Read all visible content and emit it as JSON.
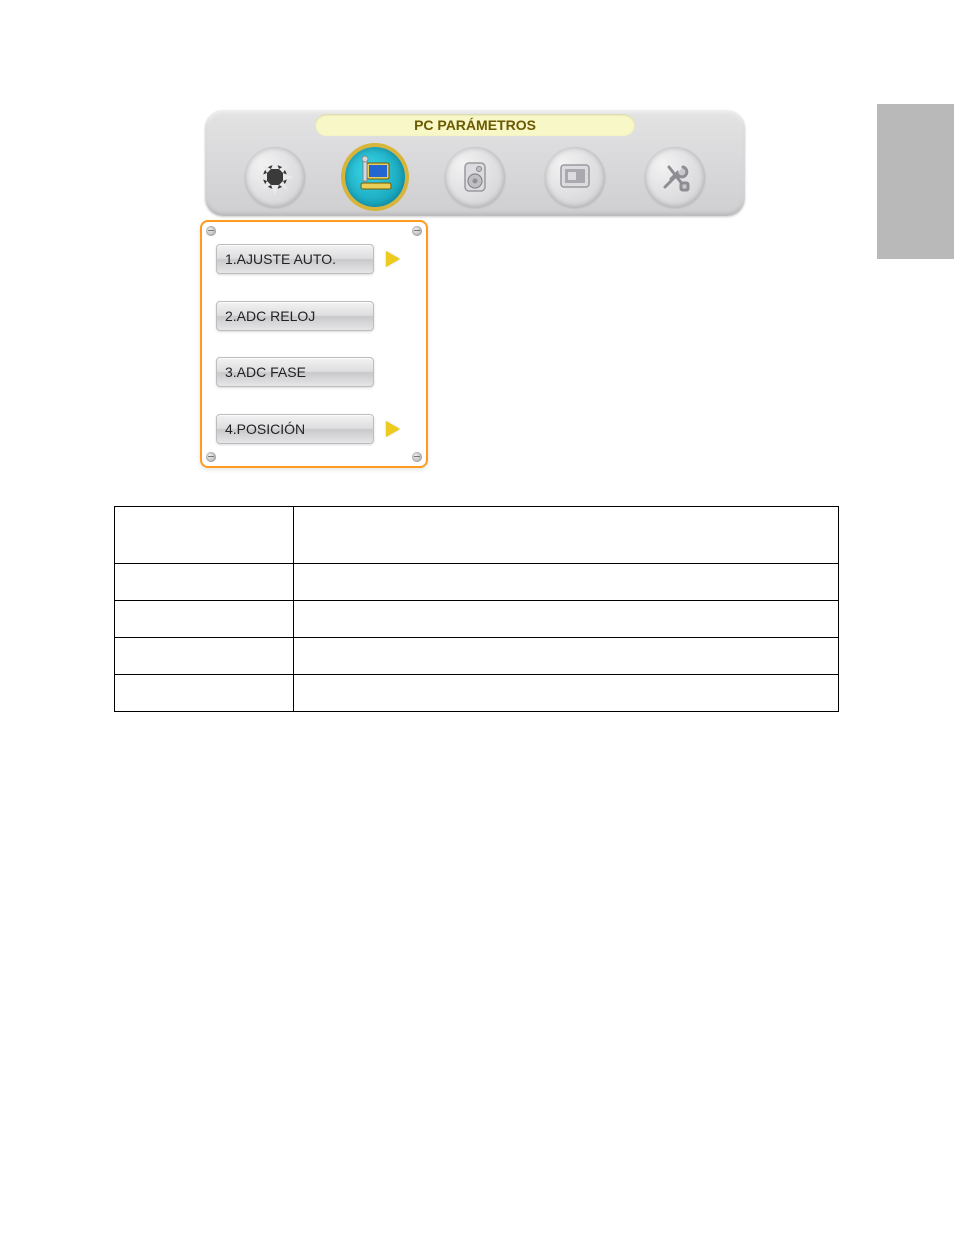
{
  "header": {
    "title": "PC PARÁMETROS"
  },
  "tabs": [
    {
      "name": "gear-icon",
      "selected": false
    },
    {
      "name": "pc-icon",
      "selected": true
    },
    {
      "name": "speaker-icon",
      "selected": false
    },
    {
      "name": "display-icon",
      "selected": false
    },
    {
      "name": "tools-icon",
      "selected": false
    }
  ],
  "submenu": [
    {
      "label": "1.AJUSTE AUTO.",
      "has_arrow": true
    },
    {
      "label": "2.ADC RELOJ",
      "has_arrow": false
    },
    {
      "label": "3.ADC FASE",
      "has_arrow": false
    },
    {
      "label": "4.POSICIÓN",
      "has_arrow": true
    }
  ],
  "table": {
    "rows": [
      {
        "left": "",
        "right": ""
      },
      {
        "left": "",
        "right": ""
      },
      {
        "left": "",
        "right": ""
      },
      {
        "left": "",
        "right": ""
      },
      {
        "left": "",
        "right": ""
      }
    ]
  }
}
